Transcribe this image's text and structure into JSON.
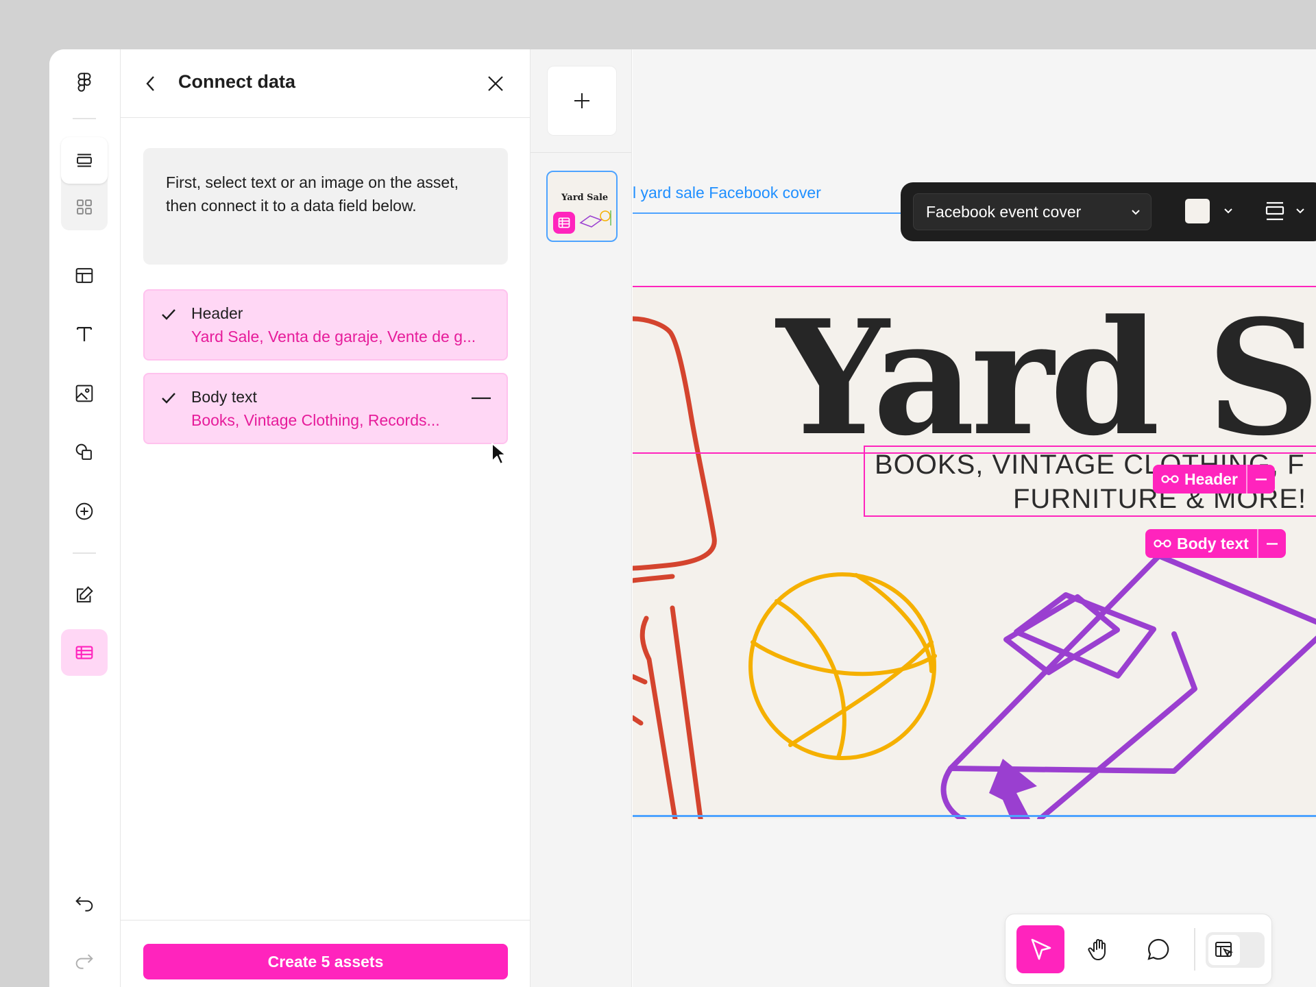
{
  "sidebar": {
    "items": [
      {
        "icon": "figma-logo-icon"
      },
      {
        "icon": "layers-icon"
      },
      {
        "icon": "assets-grid-icon"
      },
      {
        "icon": "template-icon"
      },
      {
        "icon": "text-tool-icon"
      },
      {
        "icon": "image-icon"
      },
      {
        "icon": "shapes-icon"
      },
      {
        "icon": "add-circle-icon"
      },
      {
        "icon": "edit-icon"
      },
      {
        "icon": "data-table-icon"
      },
      {
        "icon": "undo-icon"
      },
      {
        "icon": "redo-icon"
      }
    ],
    "active_item": "data-table-icon"
  },
  "panel": {
    "title": "Connect data",
    "instructions": "First, select text or an image on the asset, then connect it to a data field below.",
    "fields": [
      {
        "name": "Header",
        "values": "Yard Sale, Venta de garaje, Vente de g...",
        "connected": true
      },
      {
        "name": "Body text",
        "values": "Books, Vintage Clothing, Records...",
        "connected": true
      }
    ],
    "create_button": "Create 5 assets"
  },
  "thumbnail": {
    "title": "Yard Sale"
  },
  "canvas": {
    "frame_label": "l yard sale Facebook cover",
    "toolbar": {
      "format": "Facebook event cover",
      "fill_color": "#f4f1ec"
    },
    "artboard": {
      "header": "Yard S",
      "body_line1": "BOOKS, VINTAGE CLOTHING, F",
      "body_line2": "FURNITURE & MORE!"
    },
    "tags": {
      "header": "Header",
      "body": "Body text"
    }
  },
  "bottom_toolbar": {
    "tools": [
      "move-tool-icon",
      "hand-tool-icon",
      "comment-tool-icon",
      "dev-mode-icon"
    ],
    "active_tool": "move-tool-icon"
  },
  "colors": {
    "accent": "#ff24bd",
    "accent_light": "#ffd7f5",
    "selection_blue": "#4da3ff",
    "illustration_red": "#d4442e",
    "illustration_yellow": "#f5b000",
    "illustration_purple": "#9a3fd0"
  }
}
